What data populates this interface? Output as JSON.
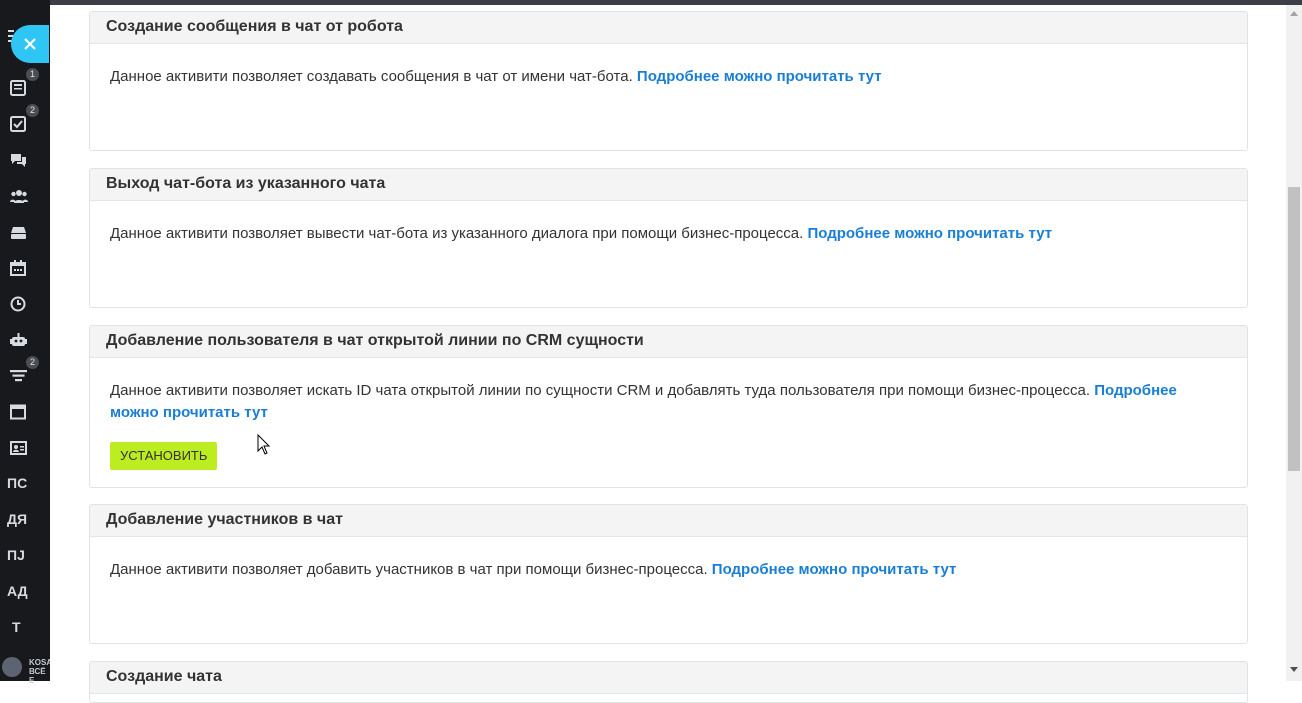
{
  "sidebar": {
    "badges": [
      "1",
      "2",
      "2"
    ],
    "text_items": [
      "ПС",
      "ДЯ",
      "ПЈ",
      "АД",
      "Т"
    ],
    "logo_text": [
      "KOSA",
      "ВСЁ Е"
    ]
  },
  "cards": [
    {
      "title": "Создание сообщения в чат от робота",
      "text": "Данное активити позволяет создавать сообщения в чат от имени чат-бота.",
      "link": "Подробнее можно прочитать тут"
    },
    {
      "title": "Выход чат-бота из указанного чата",
      "text": "Данное активити позволяет вывести чат-бота из указанного диалога при помощи бизнес-процесса.",
      "link": "Подробнее можно прочитать тут"
    },
    {
      "title": "Добавление пользователя в чат открытой линии по CRM сущности",
      "text": "Данное активити позволяет искать ID чата открытой линии по сущности CRM и добавлять туда пользователя при помощи бизнес-процесса.",
      "link": "Подробнее можно прочитать тут",
      "button": "УСТАНОВИТЬ"
    },
    {
      "title": "Добавление участников в чат",
      "text": "Данное активити позволяет добавить участников в чат при помощи бизнес-процесса.",
      "link": "Подробнее можно прочитать тут"
    },
    {
      "title": "Создание чата"
    }
  ],
  "colors": {
    "accent_link": "#1a7fd4",
    "install_button": "#bbed21",
    "close_button": "#2fc6f6",
    "sidebar_bg": "#17191c"
  }
}
